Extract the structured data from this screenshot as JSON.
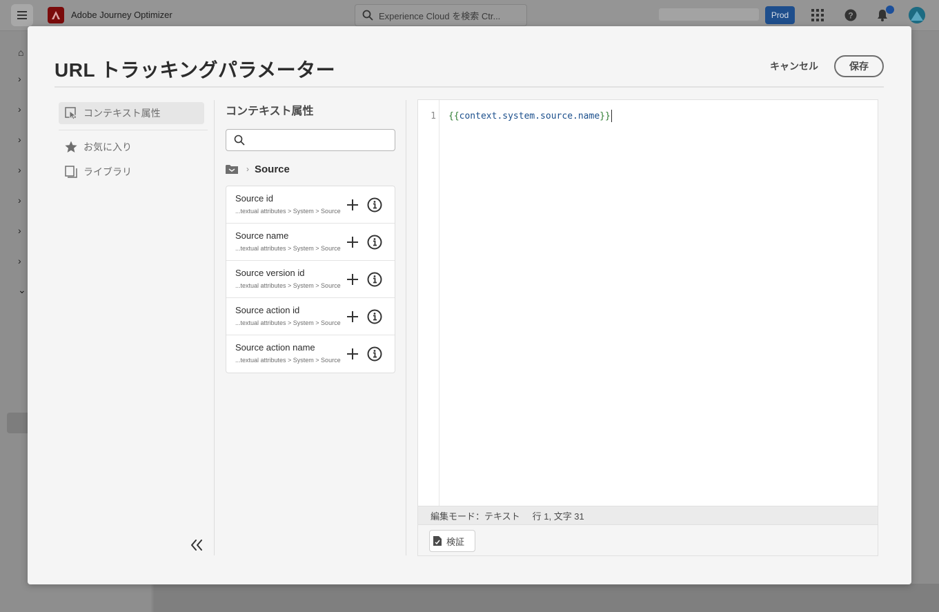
{
  "app": {
    "name": "Adobe Journey Optimizer",
    "search_placeholder": "Experience Cloud を検索 Ctr...",
    "environment_badge": "Prod"
  },
  "dialog": {
    "title": "URL トラッキングパラメーター",
    "cancel_label": "キャンセル",
    "save_label": "保存"
  },
  "categories": {
    "active": {
      "label": "コンテキスト属性",
      "icon": "select-pointer-icon"
    },
    "items": [
      {
        "label": "お気に入り",
        "icon": "star-icon"
      },
      {
        "label": "ライブラリ",
        "icon": "library-icon"
      }
    ]
  },
  "attributes_panel": {
    "heading": "コンテキスト属性",
    "search_value": "",
    "breadcrumb_current": "Source",
    "items": [
      {
        "name": "Source id",
        "path": "...textual attributes > System > Source"
      },
      {
        "name": "Source name",
        "path": "...textual attributes > System > Source"
      },
      {
        "name": "Source version id",
        "path": "...textual attributes > System > Source"
      },
      {
        "name": "Source action id",
        "path": "...textual attributes > System > Source"
      },
      {
        "name": "Source action name",
        "path": "...textual attributes > System > Source"
      }
    ]
  },
  "editor": {
    "line_number": "1",
    "code_open": "{{",
    "code_expression": "context.system.source.name",
    "code_close": "}}",
    "status_mode": "編集モード：テキスト",
    "status_position": "行 1, 文字 31",
    "validate_label": "検証"
  },
  "colors": {
    "accent_blue": "#1e4e8c",
    "brace_green": "#2e7d32",
    "expression_blue": "#1b4f8c"
  }
}
